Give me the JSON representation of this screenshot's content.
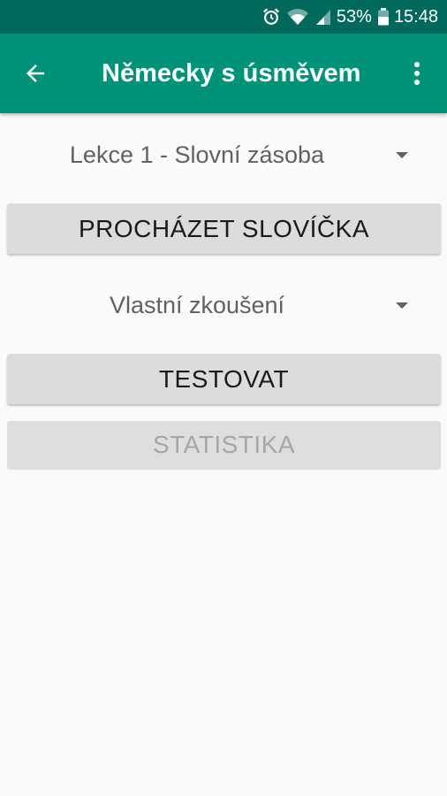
{
  "status_bar": {
    "battery": "53%",
    "time": "15:48",
    "icons": [
      "alarm-icon",
      "wifi-icon",
      "signal-icon",
      "battery-icon"
    ]
  },
  "app_bar": {
    "title": "Německy s úsměvem",
    "back_icon": "arrow-left-icon",
    "menu_icon": "more-vert-icon"
  },
  "lesson_spinner": {
    "selected": "Lekce 1 - Slovní zásoba"
  },
  "browse_button": {
    "label": "PROCHÁZET SLOVÍČKA"
  },
  "test_mode_spinner": {
    "selected": "Vlastní zkoušení"
  },
  "test_button": {
    "label": "TESTOVAT"
  },
  "stats_button": {
    "label": "STATISTIKA",
    "enabled": false
  },
  "colors": {
    "status_bar": "#00695c",
    "app_bar": "#009179",
    "background": "#fafafa",
    "button": "#dcdcdc"
  }
}
